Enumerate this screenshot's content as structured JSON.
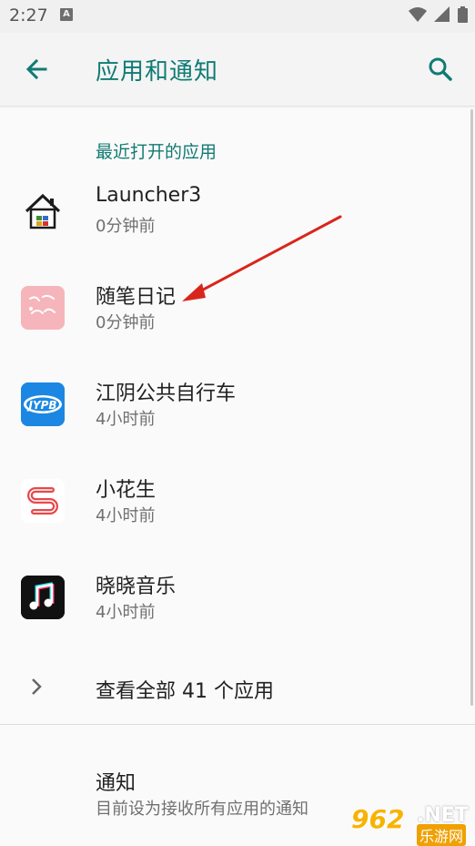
{
  "status_bar": {
    "time": "2:27",
    "notif_glyph": "A",
    "icons": [
      "wifi-icon",
      "signal-icon",
      "battery-icon"
    ]
  },
  "header": {
    "title": "应用和通知",
    "back_icon": "arrow-back-icon",
    "search_icon": "search-icon"
  },
  "section": {
    "recent_label": "最近打开的应用"
  },
  "apps": [
    {
      "name": "Launcher3",
      "time": "0分钟前",
      "icon": "launcher-house-icon"
    },
    {
      "name": "随笔日记",
      "time": "0分钟前",
      "icon": "diary-app-icon"
    },
    {
      "name": "江阴公共自行车",
      "time": "4小时前",
      "icon": "jypb-bike-icon",
      "icon_text": "JYPB"
    },
    {
      "name": "小花生",
      "time": "4小时前",
      "icon": "xiaohuasheng-icon"
    },
    {
      "name": "晓晓音乐",
      "time": "4小时前",
      "icon": "music-note-icon"
    }
  ],
  "see_all": {
    "label": "查看全部 41 个应用",
    "icon": "chevron-right-icon"
  },
  "notifications": {
    "title": "通知",
    "subtitle": "目前设为接收所有应用的通知"
  },
  "watermark": {
    "number": "962",
    "suffix": ".NET",
    "cn": "乐游网"
  },
  "colors": {
    "accent": "#0f7b74",
    "arrow": "#d9261c",
    "background": "#fafafa"
  }
}
